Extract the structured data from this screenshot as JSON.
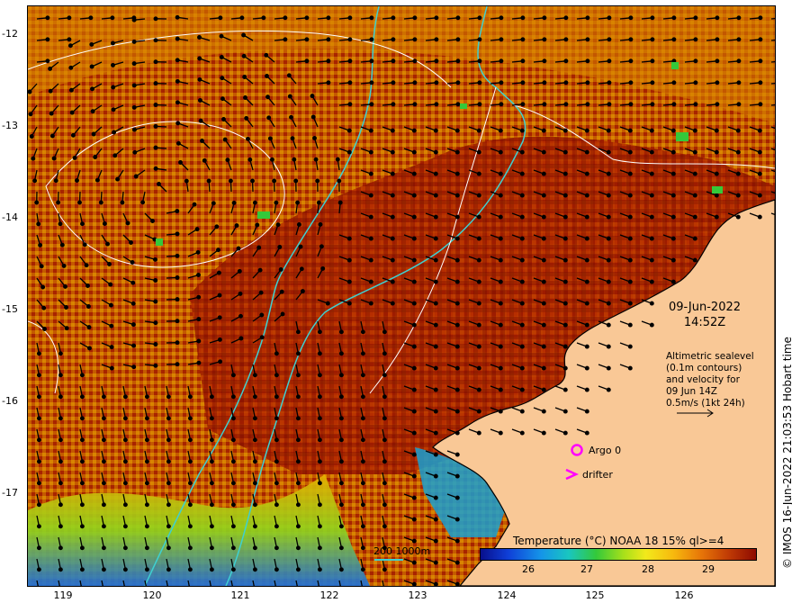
{
  "map": {
    "y_ticks": [
      "-12",
      "-13",
      "-14",
      "-15",
      "-16",
      "-17"
    ],
    "x_ticks": [
      "119",
      "120",
      "121",
      "122",
      "123",
      "124",
      "125",
      "126"
    ],
    "datetime": {
      "date": "09-Jun-2022",
      "time": "14:52Z"
    },
    "info_lines": [
      "Altimetric sealevel",
      "(0.1m contours)",
      "and velocity for",
      "09 Jun 14Z",
      "0.5m/s (1kt 24h)"
    ],
    "argo_label": "Argo 0",
    "drifter_label": "drifter",
    "contour_key": "200  1000m",
    "colorbar_title": "Temperature (°C) NOAA 18 15% ql>=4",
    "colorbar_ticks": [
      "26",
      "27",
      "28",
      "29"
    ],
    "credit": "© IMOS 16-Jun-2022 21:03:53 Hobart time"
  },
  "colors": {
    "land": "#f9c896",
    "contour_bathy": "#3fd0d0",
    "argo_marker": "#ff00ff",
    "drifter_marker": "#ff00ff",
    "sea_warm": "#a82400",
    "sea_mid": "#e2a000",
    "sea_cool": "#1fa020"
  }
}
